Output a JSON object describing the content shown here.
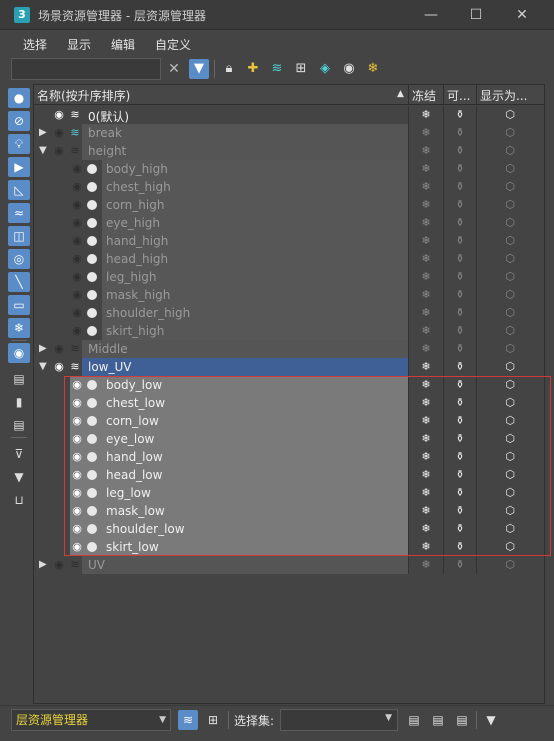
{
  "window": {
    "title": "场景资源管理器 - 层资源管理器",
    "app_icon_label": "3",
    "minimize_symbol": "—",
    "maximize_symbol": "☐",
    "close_symbol": "✕"
  },
  "menu": [
    "选择",
    "显示",
    "编辑",
    "自定义"
  ],
  "toolbar": {
    "search_value": "",
    "clear_symbol": "✕",
    "icons": [
      "filter-icon",
      "lock-icon",
      "add-layer-icon",
      "layers-icon",
      "hierarchy-icon",
      "layer-stack-icon",
      "hide-icon",
      "freeze-icon"
    ]
  },
  "columns": {
    "name": "名称(按升序排序)",
    "sort_arrow": "▲",
    "freeze": "冻结",
    "renderable": "可...",
    "display": "显示为..."
  },
  "rows": [
    {
      "name": "0(默认)"
    },
    {
      "name": "break"
    },
    {
      "name": "height"
    },
    {
      "name": "body_high"
    },
    {
      "name": "chest_high"
    },
    {
      "name": "corn_high"
    },
    {
      "name": "eye_high"
    },
    {
      "name": "hand_high"
    },
    {
      "name": "head_high"
    },
    {
      "name": "leg_high"
    },
    {
      "name": "mask_high"
    },
    {
      "name": "shoulder_high"
    },
    {
      "name": "skirt_high"
    },
    {
      "name": "Middle"
    },
    {
      "name": "low_UV"
    },
    {
      "name": "body_low"
    },
    {
      "name": "chest_low"
    },
    {
      "name": "corn_low"
    },
    {
      "name": "eye_low"
    },
    {
      "name": "hand_low"
    },
    {
      "name": "head_low"
    },
    {
      "name": "leg_low"
    },
    {
      "name": "mask_low"
    },
    {
      "name": "shoulder_low"
    },
    {
      "name": "skirt_low"
    },
    {
      "name": "UV"
    }
  ],
  "bottom": {
    "mode": "层资源管理器",
    "selection_set_label": "选择集:",
    "selection_set_value": ""
  },
  "colors": {
    "accent": "#5a8cc8",
    "selected_row": "#3f5f97",
    "highlight_box": "#d43a3a",
    "mode_text": "#e8d33a"
  }
}
